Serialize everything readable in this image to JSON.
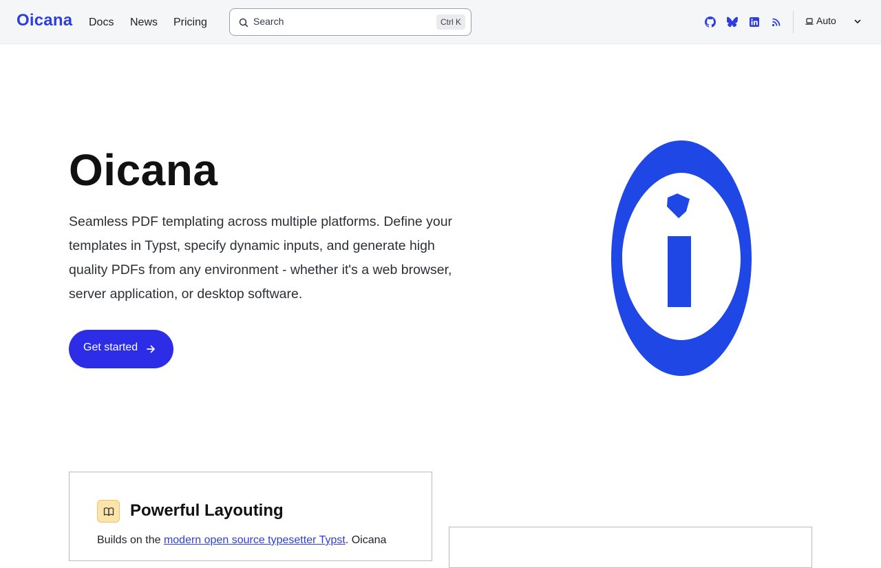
{
  "navbar": {
    "brand": "Oicana",
    "links": [
      "Docs",
      "News",
      "Pricing"
    ],
    "search": {
      "placeholder": "Search",
      "shortcut": "Ctrl K"
    },
    "social_icons": [
      "github-icon",
      "bluesky-icon",
      "linkedin-icon",
      "rss-icon"
    ],
    "theme": {
      "label": "Auto",
      "icon": "laptop-icon"
    }
  },
  "hero": {
    "title": "Oicana",
    "description": "Seamless PDF templating across multiple platforms. Define your templates in Typst, specify dynamic inputs, and generate high quality PDFs from any environment - whether it's a web browser, server application, or desktop software.",
    "cta_label": "Get started"
  },
  "features": [
    {
      "icon": "book-icon",
      "title": "Powerful Layouting",
      "text_before": "Builds on the ",
      "link_text": "modern open source typesetter Typst",
      "text_after": ". Oicana"
    }
  ],
  "colors": {
    "accent": "#2d3de0",
    "cta": "#2d2de8",
    "logo": "#1f47e6",
    "navbar_bg": "#f5f6f7"
  }
}
